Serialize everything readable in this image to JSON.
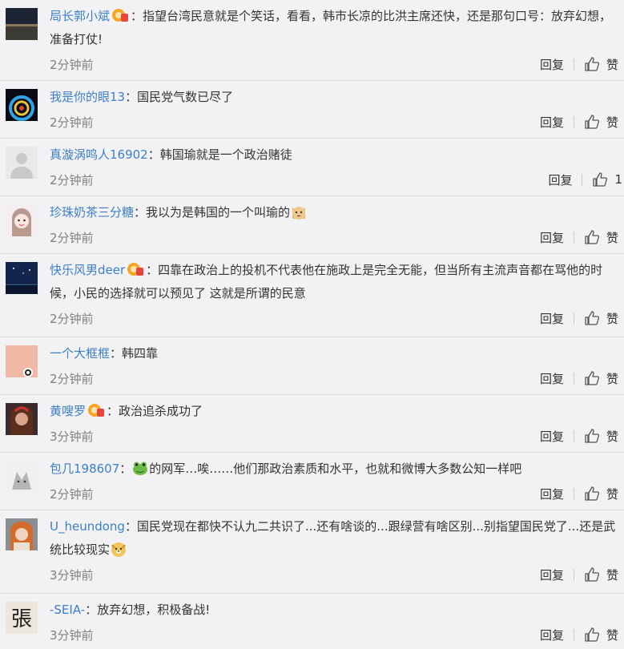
{
  "comments": [
    {
      "name": "局长郭小斌",
      "badge": true,
      "text": "指望台湾民意就是个笑话，看看，韩市长凉的比洪主席还快，还是那句口号：放弃幻想，准备打仗!",
      "emoji": "",
      "time": "2分钟前",
      "reply": "回复",
      "like": "赞"
    },
    {
      "name": "我是你的眼13",
      "badge": false,
      "text": "国民党气数已尽了",
      "emoji": "",
      "time": "2分钟前",
      "reply": "回复",
      "like": "赞"
    },
    {
      "name": "真漩涡鸣人16902",
      "badge": false,
      "text": "韩国瑜就是一个政治赌徒",
      "emoji": "",
      "time": "2分钟前",
      "reply": "回复",
      "like": "1"
    },
    {
      "name": "珍珠奶茶三分糖",
      "badge": false,
      "text": "我以为是韩国的一个叫瑜的",
      "emoji": "cat-face-icon",
      "time": "2分钟前",
      "reply": "回复",
      "like": "赞"
    },
    {
      "name": "快乐风男deer",
      "badge": true,
      "text": "四靠在政治上的投机不代表他在施政上是完全无能，但当所有主流声音都在骂他的时候，小民的选择就可以预见了 这就是所谓的民意",
      "emoji": "",
      "time": "2分钟前",
      "reply": "回复",
      "like": "赞"
    },
    {
      "name": "一个大框框",
      "badge": false,
      "text": "韩四靠",
      "emoji": "",
      "time": "2分钟前",
      "reply": "回复",
      "like": "赞"
    },
    {
      "name": "黄嗖罗",
      "badge": true,
      "text": "政治追杀成功了",
      "emoji": "",
      "time": "3分钟前",
      "reply": "回复",
      "like": "赞"
    },
    {
      "name": "包几198607",
      "badge": false,
      "text": "的网军…唉……他们那政治素质和水平，也就和微博大多数公知一样吧",
      "emoji": "frog-icon",
      "emoji_first": true,
      "time": "2分钟前",
      "reply": "回复",
      "like": "赞"
    },
    {
      "name": "U_heundong",
      "badge": false,
      "text": "国民党现在都快不认九二共识了...还有啥谈的...跟绿营有啥区别...别指望国民党了...还是武统比较现实",
      "emoji": "doge-face-icon",
      "time": "3分钟前",
      "reply": "回复",
      "like": "赞"
    },
    {
      "name": "-SEIA-",
      "badge": false,
      "text": "放弃幻想，积极备战!",
      "emoji": "",
      "time": "3分钟前",
      "reply": "回复",
      "like": "赞"
    }
  ],
  "colors": {
    "name": "#3c7fc4",
    "text": "#333333",
    "time": "#808080",
    "bg": "#f2f2f5",
    "divider": "#dcdcdc"
  }
}
